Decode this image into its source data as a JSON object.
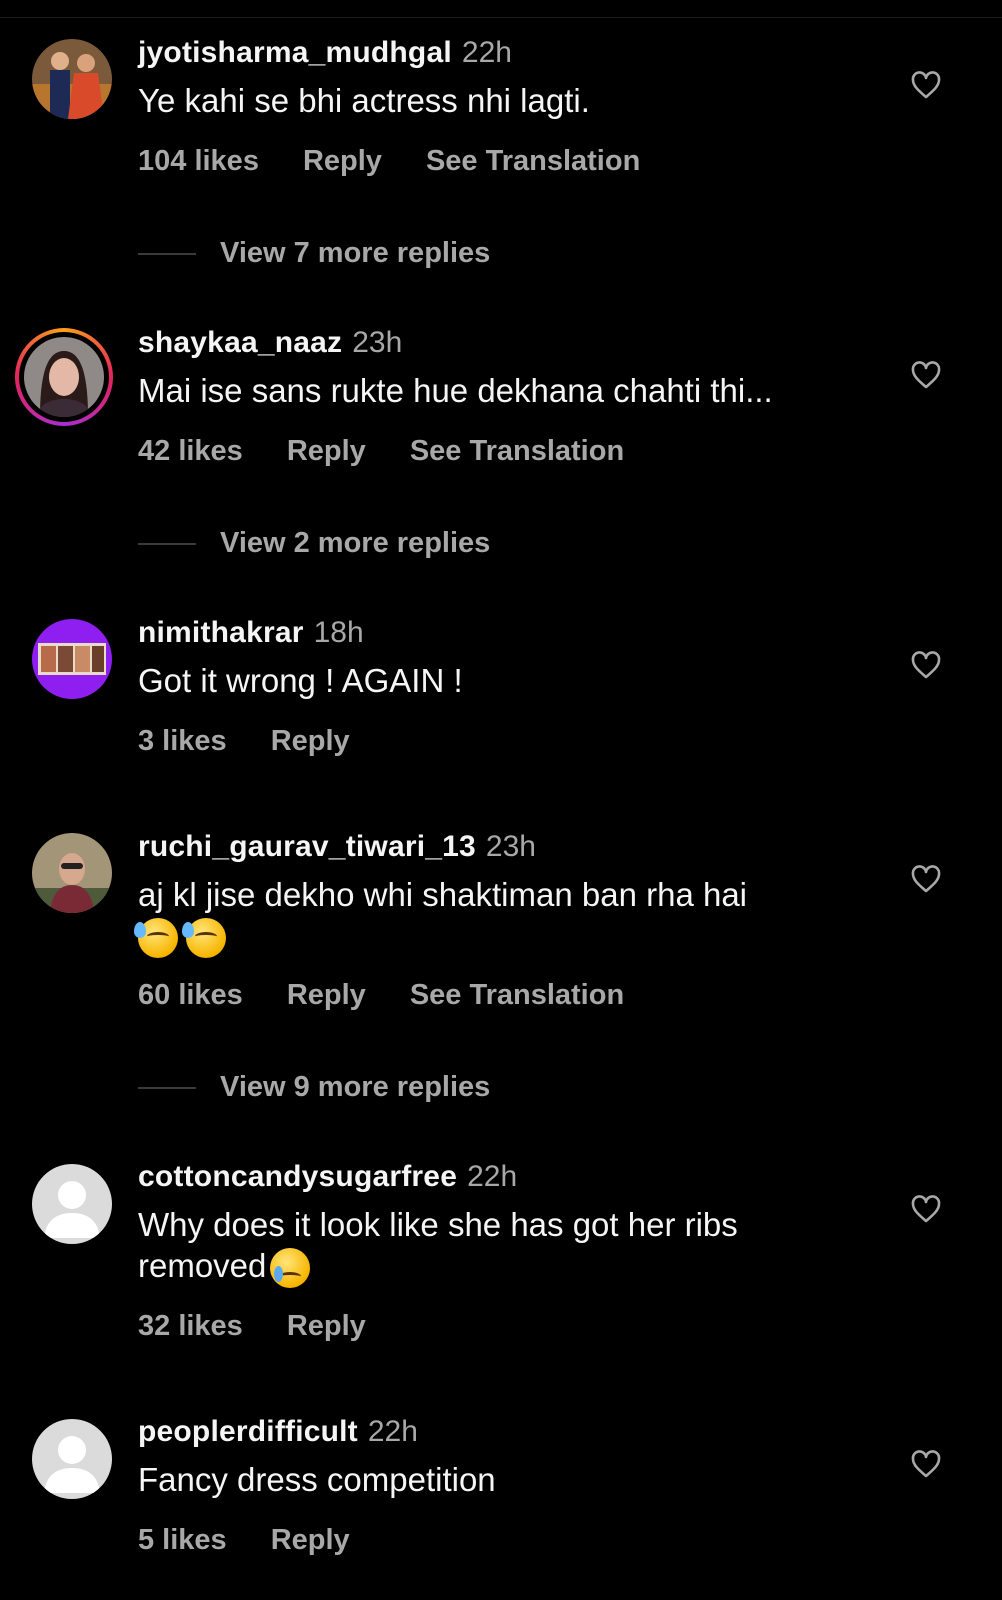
{
  "comments": [
    {
      "username": "jyotisharma_mudhgal",
      "time": "22h",
      "text": "Ye kahi se bhi actress nhi lagti.",
      "likes": "104 likes",
      "reply": "Reply",
      "translation": "See Translation",
      "more_replies": "View 7 more replies"
    },
    {
      "username": "shaykaa_naaz",
      "time": "23h",
      "text": "Mai ise sans rukte hue dekhana chahti thi...",
      "likes": "42 likes",
      "reply": "Reply",
      "translation": "See Translation",
      "more_replies": "View 2 more replies"
    },
    {
      "username": "nimithakrar",
      "time": "18h",
      "text": "Got it wrong ! AGAIN !",
      "likes": "3 likes",
      "reply": "Reply"
    },
    {
      "username": "ruchi_gaurav_tiwari_13",
      "time": "23h",
      "text": "aj kl jise dekho whi shaktiman ban rha hai",
      "emojis": [
        "grinning-sweat-emoji",
        "grinning-sweat-emoji"
      ],
      "likes": "60 likes",
      "reply": "Reply",
      "translation": "See Translation",
      "more_replies": "View 9 more replies"
    },
    {
      "username": "cottoncandysugarfree",
      "time": "22h",
      "text": "Why does it look like she has got her ribs removed",
      "emojis": [
        "crying-face-emoji"
      ],
      "likes": "32 likes",
      "reply": "Reply"
    },
    {
      "username": "peoplerdifficult",
      "time": "22h",
      "text": "Fancy dress competition",
      "likes": "5 likes",
      "reply": "Reply"
    }
  ],
  "icons": {
    "like": "heart-outline-icon",
    "default_avatar": "default-avatar-icon"
  },
  "colors": {
    "background": "#000000",
    "primary_text": "#f5f5f5",
    "secondary_text": "#a8a8a8",
    "story_ring": [
      "#f9a11b",
      "#e3245c",
      "#a92ed0"
    ]
  }
}
